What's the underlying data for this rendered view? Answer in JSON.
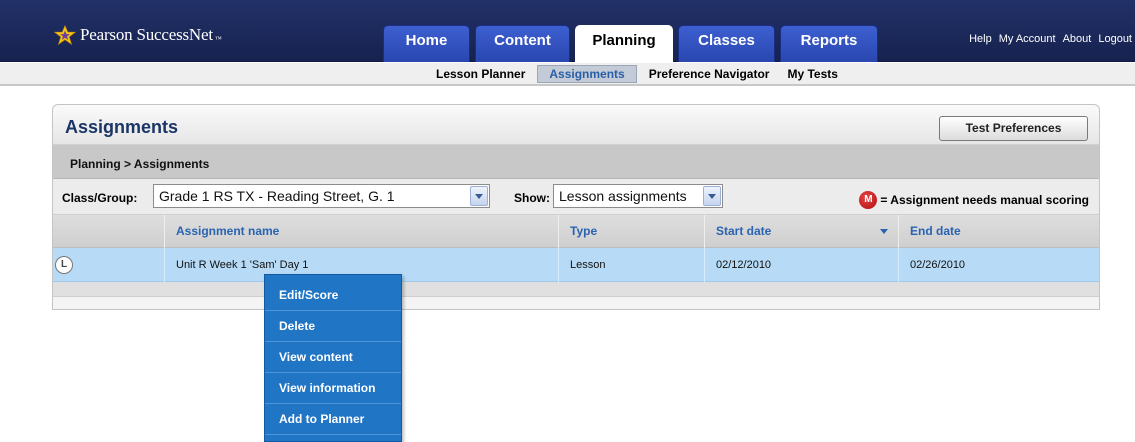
{
  "header": {
    "logo_text": "Pearson SuccessNet",
    "logo_tm": "™",
    "tabs": [
      {
        "label": "Home",
        "active": false
      },
      {
        "label": "Content",
        "active": false
      },
      {
        "label": "Planning",
        "active": true
      },
      {
        "label": "Classes",
        "active": false
      },
      {
        "label": "Reports",
        "active": false
      }
    ],
    "links": [
      "Help",
      "My Account",
      "About",
      "Logout"
    ]
  },
  "subnav": {
    "items": [
      {
        "label": "Lesson Planner",
        "active": false
      },
      {
        "label": "Assignments",
        "active": true
      },
      {
        "label": "Preference Navigator",
        "active": false
      },
      {
        "label": "My Tests",
        "active": false
      }
    ]
  },
  "panel": {
    "title": "Assignments",
    "test_pref_button": "Test Preferences",
    "breadcrumb": "Planning > Assignments",
    "class_group_label": "Class/Group:",
    "class_group_value": "Grade 1 RS TX - Reading Street, G. 1",
    "show_label": "Show:",
    "show_value": "Lesson assignments",
    "legend_badge": "M",
    "legend_text": "= Assignment needs manual scoring"
  },
  "table": {
    "columns": [
      "Assignment name",
      "Type",
      "Start date",
      "End date"
    ],
    "rows": [
      {
        "badge": "L",
        "name": "Unit R Week 1 'Sam' Day 1",
        "type": "Lesson",
        "start": "02/12/2010",
        "end": "02/26/2010"
      }
    ]
  },
  "context_menu": {
    "items": [
      "Edit/Score",
      "Delete",
      "View content",
      "View information",
      "Add to Planner"
    ]
  },
  "colors": {
    "header_bg": "#1b2a5c",
    "tab_blue": "#2f4fbf",
    "row_highlight": "#b7dbf6",
    "menu_blue": "#2175c5",
    "link_blue": "#2a63b0",
    "manual_badge": "#c41818"
  }
}
